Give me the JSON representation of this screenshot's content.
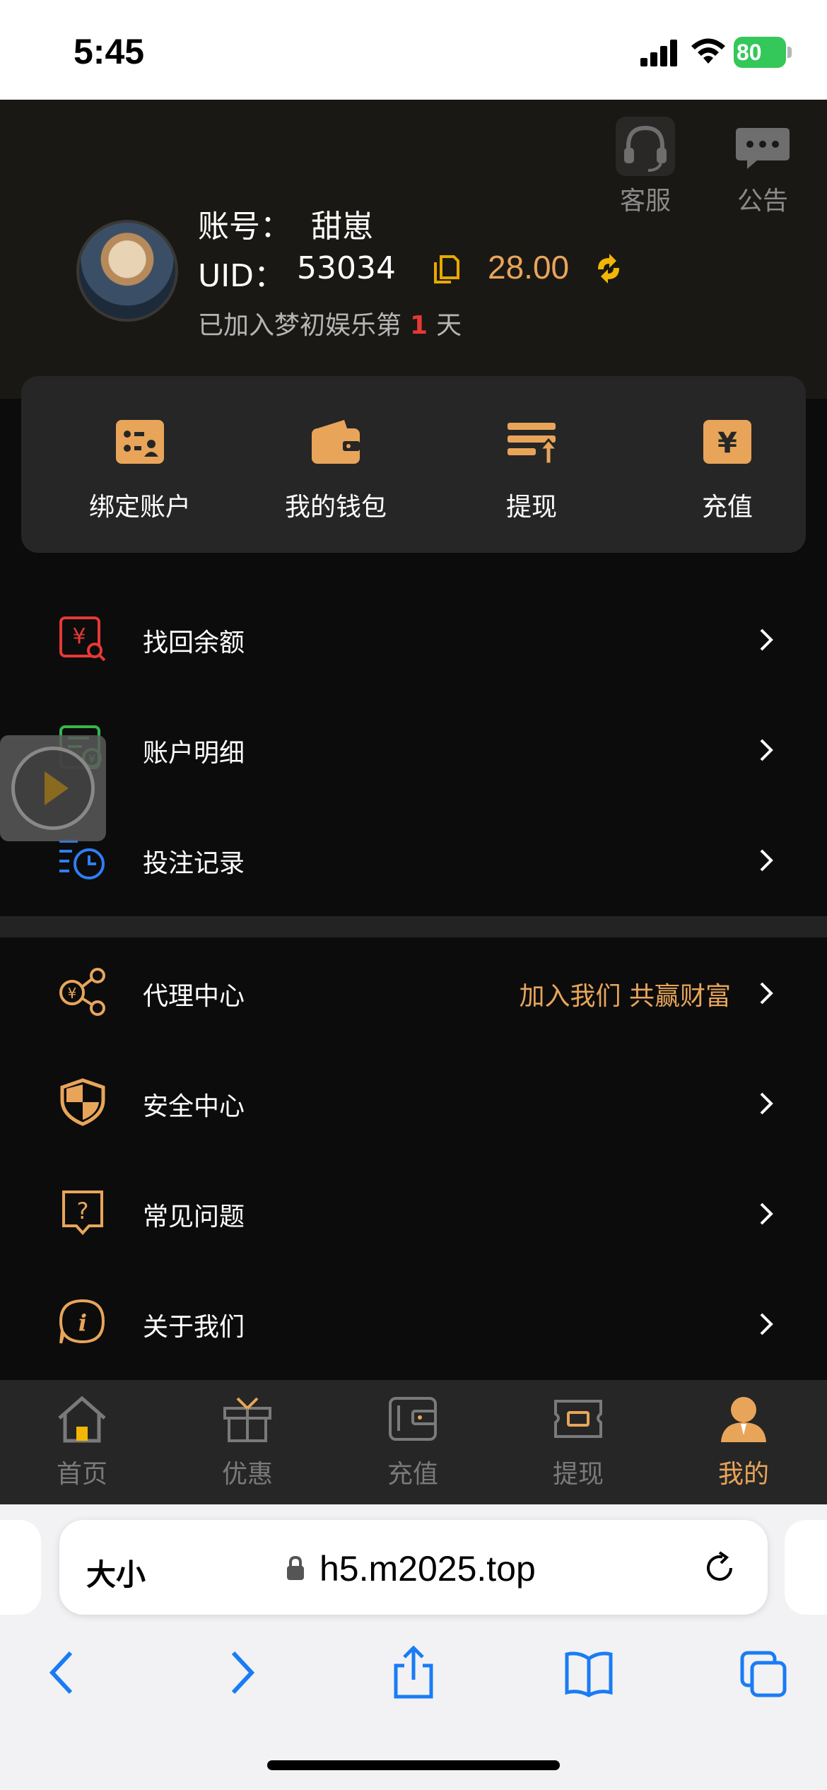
{
  "status_bar": {
    "time": "5:45",
    "battery": "80"
  },
  "header": {
    "support_label": "客服",
    "notice_label": "公告",
    "account_label": "账号：",
    "account_value": "甜崽",
    "uid_label": "UID：",
    "uid_value": "53034",
    "balance": "28.00",
    "joined_prefix": "已加入梦初娱乐第",
    "joined_days": "1",
    "joined_suffix": "天"
  },
  "quick_actions": [
    {
      "label": "绑定账户",
      "icon": "bind-account-icon"
    },
    {
      "label": "我的钱包",
      "icon": "wallet-icon"
    },
    {
      "label": "提现",
      "icon": "withdraw-icon"
    },
    {
      "label": "充值",
      "icon": "recharge-icon"
    }
  ],
  "menu_group_1": [
    {
      "label": "找回余额",
      "icon": "recover-balance-icon"
    },
    {
      "label": "账户明细",
      "icon": "account-details-icon"
    },
    {
      "label": "投注记录",
      "icon": "bet-records-icon"
    }
  ],
  "menu_group_2": [
    {
      "label": "代理中心",
      "extra": "加入我们 共赢财富",
      "icon": "agent-center-icon"
    },
    {
      "label": "安全中心",
      "icon": "security-center-icon"
    },
    {
      "label": "常见问题",
      "icon": "faq-icon"
    },
    {
      "label": "关于我们",
      "icon": "about-us-icon"
    }
  ],
  "tabs": [
    {
      "label": "首页",
      "icon": "home-icon",
      "active": false
    },
    {
      "label": "优惠",
      "icon": "gift-icon",
      "active": false
    },
    {
      "label": "充值",
      "icon": "recharge-tab-icon",
      "active": false
    },
    {
      "label": "提现",
      "icon": "withdraw-tab-icon",
      "active": false
    },
    {
      "label": "我的",
      "icon": "profile-icon",
      "active": true
    }
  ],
  "browser": {
    "text_size_label": "大小",
    "url": "h5.m2025.top"
  },
  "colors": {
    "accent": "#e8a55a",
    "background": "#0c0c0c",
    "card": "#262626",
    "highlight_red": "#e53935"
  }
}
